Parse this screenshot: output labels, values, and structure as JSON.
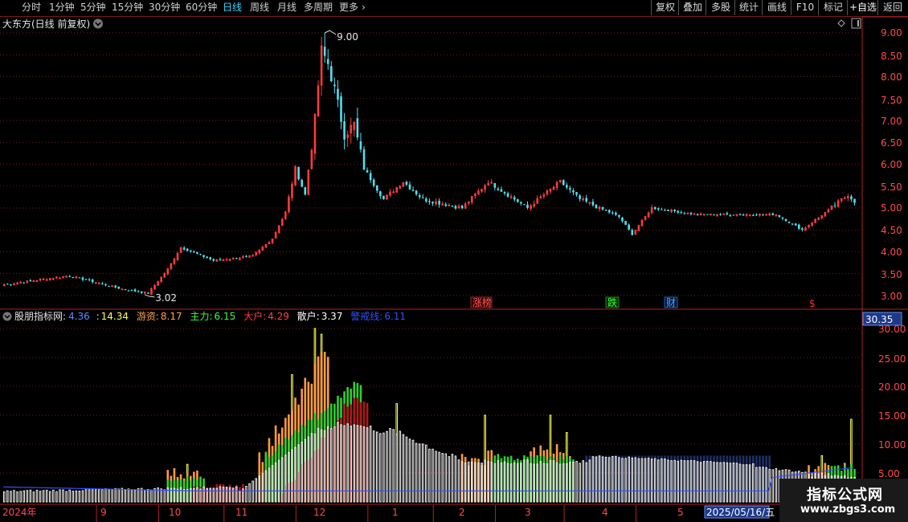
{
  "toolbar": {
    "periods": [
      "分时",
      "1分钟",
      "5分钟",
      "15分钟",
      "30分钟",
      "60分钟",
      "日线",
      "周线",
      "月线",
      "多周期",
      "更多"
    ],
    "selected_index": 6,
    "more_chevron": "›",
    "right_buttons": [
      "复权",
      "叠加",
      "多股",
      "统计",
      "画线",
      "F10",
      "标记",
      "+自选",
      "返回"
    ]
  },
  "main_panel": {
    "title": "大东方(日线 前复权)",
    "high_label": "9.00",
    "low_label": "3.02",
    "y_ticks": [
      "9.00",
      "8.50",
      "8.00",
      "7.50",
      "7.00",
      "6.50",
      "6.00",
      "5.50",
      "5.00",
      "4.50",
      "4.00",
      "3.50",
      "3.00"
    ],
    "markers": [
      {
        "text": "涨榜",
        "color": "#ff5a5a"
      },
      {
        "text": "跌",
        "color": "#3cff3c"
      },
      {
        "text": "财",
        "color": "#5aa0ff"
      },
      {
        "text": "$",
        "color": "#ff3030"
      }
    ]
  },
  "sub_panel": {
    "title": "股朋指标网",
    "legend": [
      {
        "name": "",
        "value": "4.36",
        "color": "#5a8cff"
      },
      {
        "name": "",
        "value": "14.34",
        "color": "#ffff50"
      },
      {
        "name": "游资",
        "value": "8.17",
        "color": "#ffa050"
      },
      {
        "name": "主力",
        "value": "6.15",
        "color": "#3cff3c"
      },
      {
        "name": "大户",
        "value": "4.29",
        "color": "#ff4040"
      },
      {
        "name": "散户",
        "value": "3.37",
        "color": "#ffffff"
      },
      {
        "name": "警戒线",
        "value": "6.11",
        "color": "#3050ff"
      }
    ],
    "current_value": "30.35",
    "y_ticks": [
      "30.00",
      "25.00",
      "20.00",
      "15.00",
      "10.00",
      "5.00"
    ]
  },
  "x_axis": {
    "labels": [
      "2024年",
      "9",
      "10",
      "11",
      "12",
      "1",
      "2",
      "3",
      "4",
      "5"
    ],
    "cursor_date": "2025/05/16/五"
  },
  "watermark": {
    "line1": "指标公式网",
    "line2": "www.zbgs3.com"
  },
  "colors": {
    "up": "#ff3c3c",
    "down": "#50e0f0",
    "grid": "#7a1a1a",
    "axis": "#b02020"
  },
  "chart_data": {
    "type": "candlestick",
    "price_ylim": [
      3.0,
      9.0
    ],
    "indicator_ylim": [
      0,
      30
    ],
    "anchors": [
      {
        "x": 0,
        "close": 3.25
      },
      {
        "x": 20,
        "close": 3.45
      },
      {
        "x": 36,
        "close": 3.15
      },
      {
        "x": 44,
        "close": 3.05
      },
      {
        "x": 50,
        "close": 3.6
      },
      {
        "x": 54,
        "close": 4.1
      },
      {
        "x": 64,
        "close": 3.8
      },
      {
        "x": 76,
        "close": 3.9
      },
      {
        "x": 82,
        "close": 4.3
      },
      {
        "x": 86,
        "close": 4.9
      },
      {
        "x": 89,
        "close": 5.9
      },
      {
        "x": 92,
        "close": 5.3
      },
      {
        "x": 95,
        "close": 7.0
      },
      {
        "x": 97,
        "close": 8.6
      },
      {
        "x": 99,
        "close": 8.3
      },
      {
        "x": 101,
        "close": 7.7
      },
      {
        "x": 104,
        "close": 6.7
      },
      {
        "x": 107,
        "close": 6.9
      },
      {
        "x": 110,
        "close": 5.9
      },
      {
        "x": 116,
        "close": 5.2
      },
      {
        "x": 122,
        "close": 5.6
      },
      {
        "x": 128,
        "close": 5.2
      },
      {
        "x": 140,
        "close": 5.0
      },
      {
        "x": 148,
        "close": 5.6
      },
      {
        "x": 160,
        "close": 5.0
      },
      {
        "x": 170,
        "close": 5.6
      },
      {
        "x": 176,
        "close": 5.2
      },
      {
        "x": 188,
        "close": 4.8
      },
      {
        "x": 192,
        "close": 4.4
      },
      {
        "x": 198,
        "close": 5.0
      },
      {
        "x": 212,
        "close": 4.85
      },
      {
        "x": 236,
        "close": 4.85
      },
      {
        "x": 244,
        "close": 4.5
      },
      {
        "x": 252,
        "close": 4.95
      },
      {
        "x": 258,
        "close": 5.3
      },
      {
        "x": 260,
        "close": 5.15
      }
    ],
    "month_starts": [
      {
        "label": "9",
        "x": 29
      },
      {
        "label": "10",
        "x": 48
      },
      {
        "label": "11",
        "x": 68
      },
      {
        "label": "12",
        "x": 90
      },
      {
        "label": "1",
        "x": 112
      },
      {
        "label": "2",
        "x": 132
      },
      {
        "label": "3",
        "x": 151
      },
      {
        "label": "4",
        "x": 172
      },
      {
        "label": "5",
        "x": 194
      }
    ]
  }
}
